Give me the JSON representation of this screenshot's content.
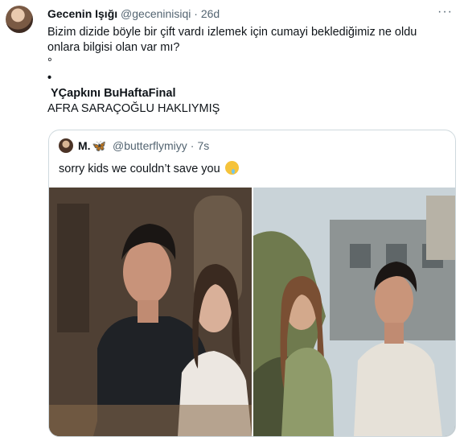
{
  "tweet": {
    "author_name": "Gecenin Işığı",
    "author_handle": "@geceninisiqi",
    "separator": "·",
    "time": "26d",
    "more": "···",
    "text_line1": "Bizim dizide böyle bir çift vardı izlemek için cumayi beklediğimiz ne oldu",
    "text_line2": "onlara bilgisi olan var mı?",
    "dot1": "°",
    "dot2": "•",
    "hashtag_line": "YÇapkını BuHaftaFinal",
    "caps_line": "AFRA SARAÇOĞLU HAKLIYMIŞ"
  },
  "quote": {
    "author_name": "M.",
    "butterfly": "🦋",
    "author_handle": "@butterflymiyy",
    "separator": "·",
    "time": "7s",
    "text": "sorry kids we couldn’t save you"
  },
  "icons": {
    "avatar": "profile-photo",
    "quote_avatar": "profile-photo",
    "emoji": "melting-face-emoji"
  }
}
